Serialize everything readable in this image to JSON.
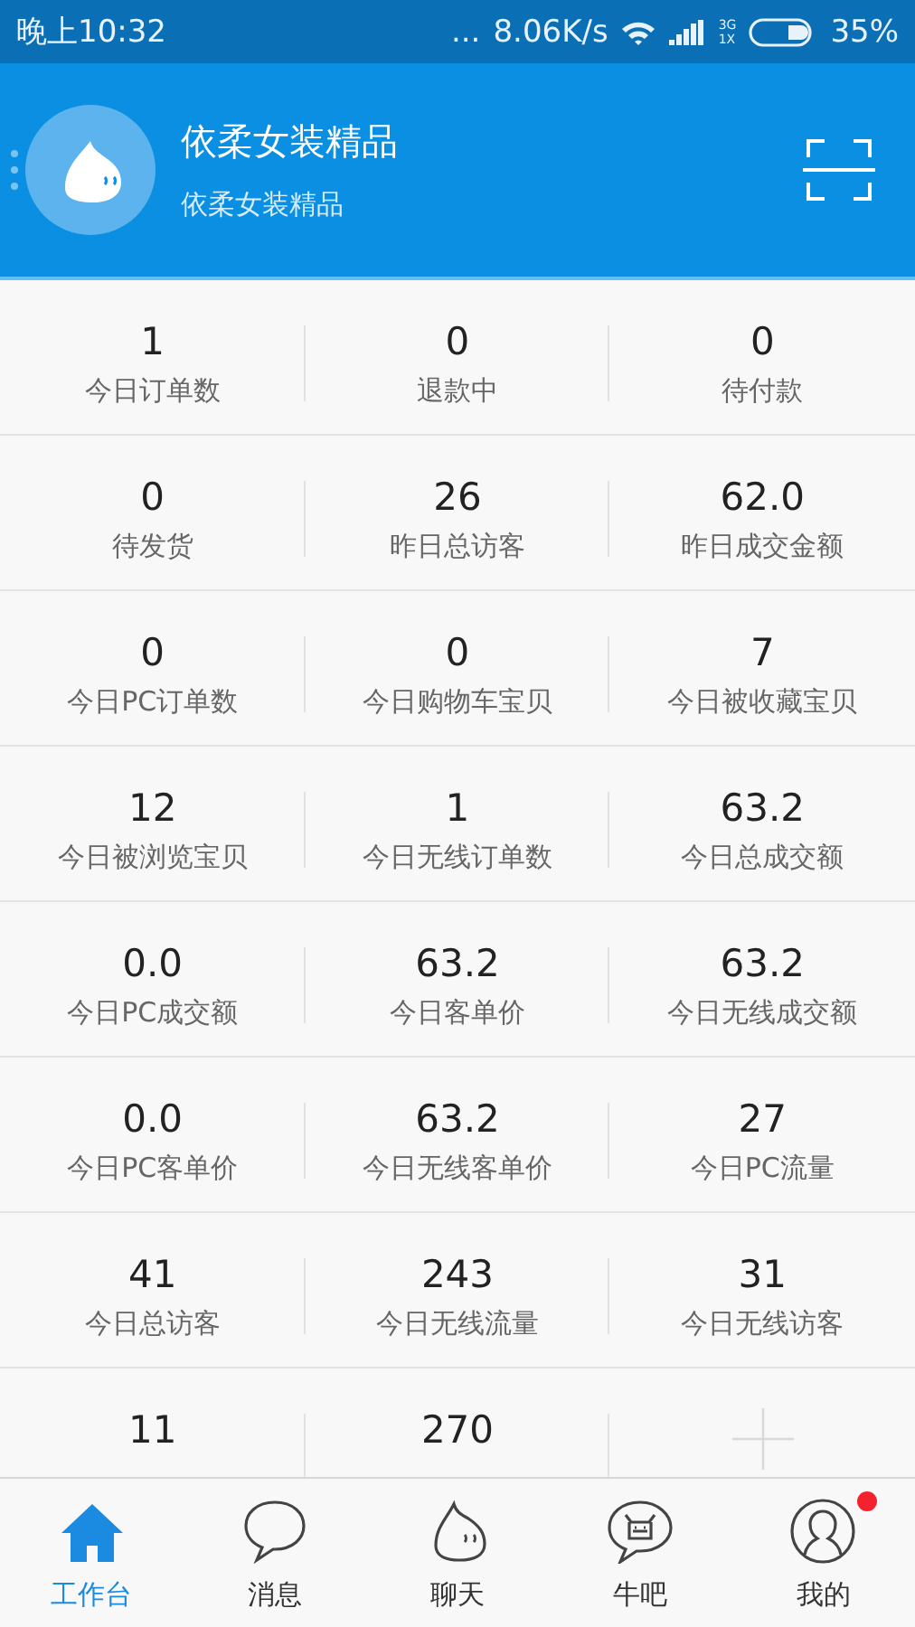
{
  "status_bar": {
    "time": "晚上10:32",
    "dots": "...",
    "speed": "8.06K/s",
    "network": "3G",
    "network_alt": "1X",
    "battery": "35%"
  },
  "header": {
    "title": "依柔女装精品",
    "subtitle": "依柔女装精品"
  },
  "stats": [
    {
      "value": "1",
      "label": "今日订单数"
    },
    {
      "value": "0",
      "label": "退款中"
    },
    {
      "value": "0",
      "label": "待付款"
    },
    {
      "value": "0",
      "label": "待发货"
    },
    {
      "value": "26",
      "label": "昨日总访客"
    },
    {
      "value": "62.0",
      "label": "昨日成交金额"
    },
    {
      "value": "0",
      "label": "今日PC订单数"
    },
    {
      "value": "0",
      "label": "今日购物车宝贝"
    },
    {
      "value": "7",
      "label": "今日被收藏宝贝"
    },
    {
      "value": "12",
      "label": "今日被浏览宝贝"
    },
    {
      "value": "1",
      "label": "今日无线订单数"
    },
    {
      "value": "63.2",
      "label": "今日总成交额"
    },
    {
      "value": "0.0",
      "label": "今日PC成交额"
    },
    {
      "value": "63.2",
      "label": "今日客单价"
    },
    {
      "value": "63.2",
      "label": "今日无线成交额"
    },
    {
      "value": "0.0",
      "label": "今日PC客单价"
    },
    {
      "value": "63.2",
      "label": "今日无线客单价"
    },
    {
      "value": "27",
      "label": "今日PC流量"
    },
    {
      "value": "41",
      "label": "今日总访客"
    },
    {
      "value": "243",
      "label": "今日无线流量"
    },
    {
      "value": "31",
      "label": "今日无线访客"
    },
    {
      "value": "11"
    },
    {
      "value": "270"
    },
    {
      "kind": "add"
    }
  ],
  "tabs": [
    {
      "label": "工作台",
      "kind": "home",
      "selected": true,
      "badge": false
    },
    {
      "label": "消息",
      "kind": "bubble",
      "selected": false,
      "badge": false
    },
    {
      "label": "聊天",
      "kind": "mascot",
      "selected": false,
      "badge": false
    },
    {
      "label": "牛吧",
      "kind": "cow",
      "selected": false,
      "badge": false
    },
    {
      "label": "我的",
      "kind": "person",
      "selected": false,
      "badge": true
    }
  ]
}
